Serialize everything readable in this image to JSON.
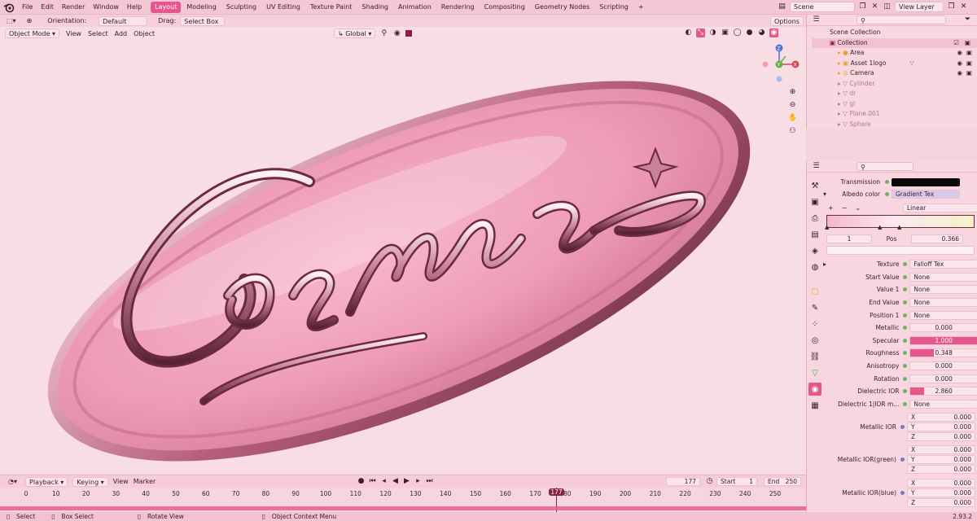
{
  "menu": {
    "items": [
      "File",
      "Edit",
      "Render",
      "Window",
      "Help"
    ]
  },
  "workspaces": [
    "Layout",
    "Modeling",
    "Sculpting",
    "UV Editing",
    "Texture Paint",
    "Shading",
    "Animation",
    "Rendering",
    "Compositing",
    "Geometry Nodes",
    "Scripting"
  ],
  "scene": {
    "name": "Scene",
    "view_layer": "View Layer"
  },
  "toolbar": {
    "orientation_label": "Orientation:",
    "orientation_value": "Default",
    "drag_label": "Drag:",
    "drag_value": "Select Box",
    "options": "Options"
  },
  "transform": {
    "global": "Global"
  },
  "viewport_header": {
    "mode": "Object Mode",
    "menus": [
      "View",
      "Select",
      "Add",
      "Object"
    ]
  },
  "outliner": {
    "title": "Scene Collection",
    "collection": "Collection",
    "items": [
      "Area",
      "Asset 1logo",
      "Camera",
      "Cylinder",
      "dr",
      "gl",
      "Plane.001",
      "Sphere"
    ]
  },
  "properties": {
    "transmission_label": "Transmission",
    "albedo_label": "Albedo color",
    "albedo_value": "Gradient Tex",
    "interp": "Linear",
    "ramp_index": "1",
    "pos_label": "Pos",
    "pos_value": "0.366",
    "rows": [
      {
        "label": "Texture",
        "value": "Falloff Tex"
      },
      {
        "label": "Start Value",
        "value": "None"
      },
      {
        "label": "Value 1",
        "value": "None"
      },
      {
        "label": "End Value",
        "value": "None"
      },
      {
        "label": "Position 1",
        "value": "None"
      },
      {
        "label": "Metallic",
        "value": "0.000"
      },
      {
        "label": "Specular",
        "value": "1.000"
      },
      {
        "label": "Roughness",
        "value": "0.348"
      },
      {
        "label": "Anisotropy",
        "value": "0.000"
      },
      {
        "label": "Rotation",
        "value": "0.000"
      },
      {
        "label": "Dielectric IOR",
        "value": "2.860"
      },
      {
        "label": "Dielectric 1|IOR m...",
        "value": "None"
      }
    ],
    "metallic_ior": {
      "label": "Metallic IOR",
      "x": "0.000",
      "y": "0.000",
      "z": "0.000"
    },
    "metallic_ior_green": {
      "label": "Metallic IOR(green)",
      "x": "0.000",
      "y": "0.000",
      "z": "0.000"
    },
    "metallic_ior_blue": {
      "label": "Metallic IOR(blue)",
      "x": "0.000",
      "y": "0.000",
      "z": "0.000"
    },
    "axis": {
      "x": "X",
      "y": "Y",
      "z": "Z"
    }
  },
  "timeline": {
    "menus": [
      "Playback",
      "Keying",
      "View",
      "Marker"
    ],
    "current_frame": "177",
    "start_label": "Start",
    "start": "1",
    "end_label": "End",
    "end": "250",
    "ticks": [
      "0",
      "10",
      "20",
      "30",
      "40",
      "50",
      "60",
      "70",
      "80",
      "90",
      "100",
      "110",
      "120",
      "130",
      "140",
      "150",
      "160",
      "170",
      "180",
      "190",
      "200",
      "210",
      "220",
      "230",
      "240",
      "250"
    ],
    "playhead": "177"
  },
  "status": {
    "select": "Select",
    "box_select": "Box Select",
    "rotate": "Rotate View",
    "context": "Object Context Menu",
    "version": "2.93.2"
  },
  "artwork": {
    "text": "Cosmic"
  },
  "colors": {
    "accent": "#e5578c",
    "bg": "#f9dde5"
  }
}
